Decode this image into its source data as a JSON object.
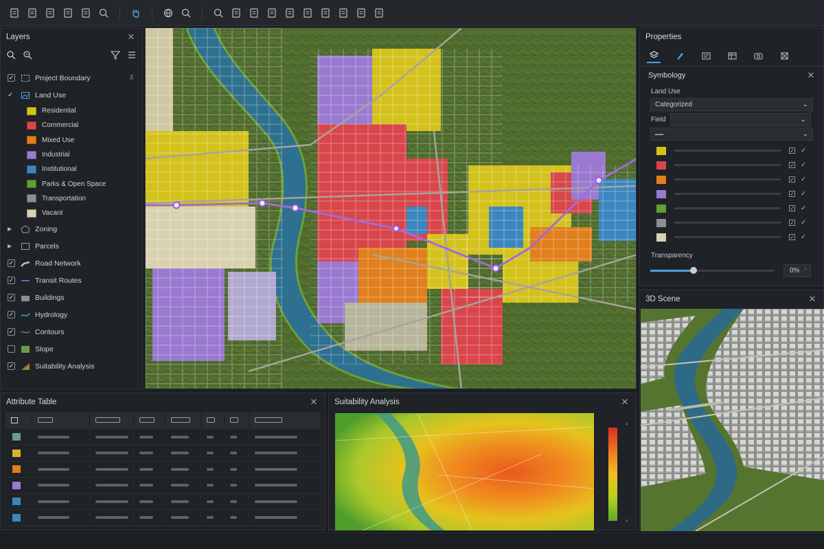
{
  "toolbar": {
    "icons": [
      "new-file-icon",
      "open-file-icon",
      "edit-file-icon",
      "export-icon",
      "print-icon",
      "zoom-in-icon",
      "pan-hand-icon",
      "globe-icon",
      "zoom-icon",
      "zoom-out-icon",
      "select-icon",
      "image-icon",
      "layer-edit-icon",
      "measure-icon",
      "identify-icon",
      "settings-icon",
      "export-map-icon",
      "table-icon",
      "layout-icon"
    ]
  },
  "layers": {
    "title": "Layers",
    "items": [
      {
        "label": "Project Boundary",
        "state": "checked",
        "icon": "boundary-icon"
      },
      {
        "label": "Land Use",
        "state": "expanded-checked",
        "icon": "land-use-icon"
      },
      {
        "label": "Zoning",
        "state": "collapsed",
        "icon": "zoning-icon"
      },
      {
        "label": "Parcels",
        "state": "collapsed",
        "icon": "parcels-icon"
      },
      {
        "label": "Road Network",
        "state": "checked",
        "icon": "road-icon"
      },
      {
        "label": "Transit Routes",
        "state": "checked",
        "icon": "transit-icon"
      },
      {
        "label": "Buildings",
        "state": "checked",
        "icon": "buildings-icon"
      },
      {
        "label": "Hydrology",
        "state": "checked",
        "icon": "hydrology-icon"
      },
      {
        "label": "Contours",
        "state": "checked",
        "icon": "contours-icon"
      },
      {
        "label": "Slope",
        "state": "unchecked",
        "icon": "slope-icon"
      },
      {
        "label": "Suitability Analysis",
        "state": "checked",
        "icon": "suitability-icon"
      }
    ],
    "land_use_classes": [
      {
        "label": "Residential",
        "color": "#d4c21c"
      },
      {
        "label": "Commercial",
        "color": "#d8464b"
      },
      {
        "label": "Mixed Use",
        "color": "#e07f1c"
      },
      {
        "label": "Industrial",
        "color": "#9a7ad0"
      },
      {
        "label": "Institutional",
        "color": "#3c86c0"
      },
      {
        "label": "Parks & Open Space",
        "color": "#5f9f34"
      },
      {
        "label": "Transportation",
        "color": "#8d9093"
      },
      {
        "label": "Vacant",
        "color": "#d9d2b0"
      }
    ]
  },
  "properties": {
    "title": "Properties",
    "section": "Symbology",
    "layer_label": "Land Use",
    "renderer": "Categorized",
    "field_label": "Field",
    "field_value": "",
    "symbol_colors": [
      "#d4c21c",
      "#d8464b",
      "#e07f1c",
      "#9a7ad0",
      "#5f9f34",
      "#8d9093",
      "#d9d2b0"
    ],
    "transparency_label": "Transparency",
    "transparency_value": "0%",
    "transparency_fraction": 0.35
  },
  "scene": {
    "title": "3D Scene"
  },
  "attribute_table": {
    "title": "Attribute Table",
    "row_colors": [
      "#6f9a86",
      "#d4b22c",
      "#e07f1c",
      "#9a7ad0",
      "#3c86c0",
      "#3c86c0"
    ]
  },
  "suitability": {
    "title": "Suitability Analysis"
  }
}
